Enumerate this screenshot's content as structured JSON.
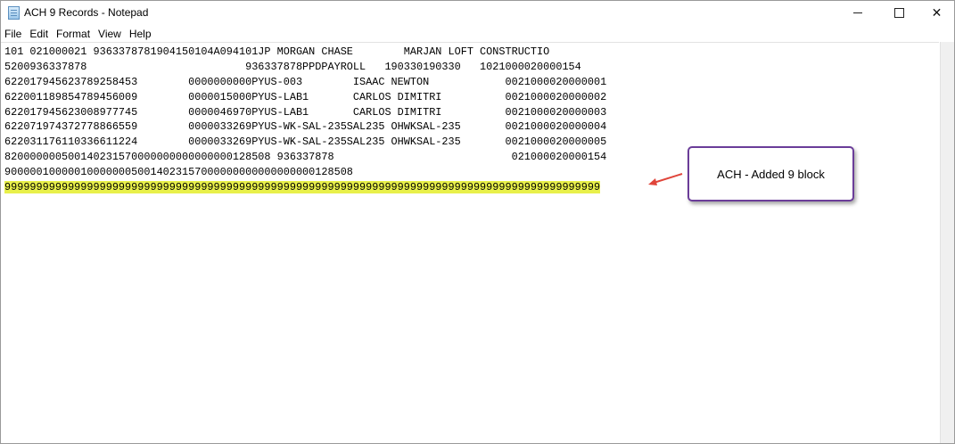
{
  "window": {
    "title": "ACH 9 Records - Notepad",
    "icon": "notepad-icon",
    "controls": {
      "minimize": "minimize-icon",
      "maximize": "maximize-icon",
      "close": "close-icon",
      "close_glyph": "✕"
    }
  },
  "menu": {
    "items": [
      "File",
      "Edit",
      "Format",
      "View",
      "Help"
    ]
  },
  "editor": {
    "lines": [
      "101 021000021 9363378781904150104A094101JP MORGAN CHASE        MARJAN LOFT CONSTRUCTIO",
      "5200936337878                         936337878PPDPAYROLL   190330190330   1021000020000154",
      "622017945623789258453        0000000000PYUS-003        ISAAC NEWTON            0021000020000001",
      "622001189854789456009        0000015000PYUS-LAB1       CARLOS DIMITRI          0021000020000002",
      "622017945623008977745        0000046970PYUS-LAB1       CARLOS DIMITRI          0021000020000003",
      "622071974372778866559        0000033269PYUS-WK-SAL-235SAL235 OHWKSAL-235       0021000020000004",
      "622031176110336611224        0000033269PYUS-WK-SAL-235SAL235 OHWKSAL-235       0021000020000005",
      "820000000500140231570000000000000000128508 936337878                            021000020000154",
      "9000001000001000000050014023157000000000000000000128508",
      "9999999999999999999999999999999999999999999999999999999999999999999999999999999999999999999999"
    ],
    "highlighted_line_index": 9,
    "highlight_color": "#e8f04a"
  },
  "annotation": {
    "callout_text": "ACH - Added 9 block",
    "border_color": "#6b3d99",
    "arrow_color": "#e0453a"
  }
}
